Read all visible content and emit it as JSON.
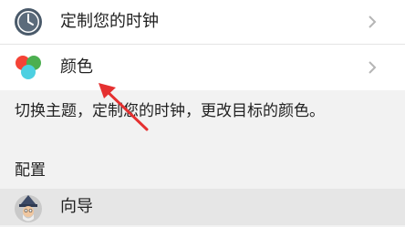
{
  "rows": {
    "clock": {
      "label": "定制您的时钟",
      "icon": "clock-icon"
    },
    "color": {
      "label": "颜色",
      "icon": "color-dots-icon"
    },
    "guide": {
      "label": "向导",
      "icon": "wizard-avatar-icon"
    }
  },
  "description": "切换主题，定制您的时钟，更改目标的颜色。",
  "section": {
    "title": "配置"
  },
  "colors": {
    "accent_red": "#e53935",
    "annotation_arrow": "#e53030",
    "dot_red": "#f44336",
    "dot_green": "#4caf50",
    "dot_cyan": "#4dd0e1",
    "chevron": "#b5b5b5"
  }
}
